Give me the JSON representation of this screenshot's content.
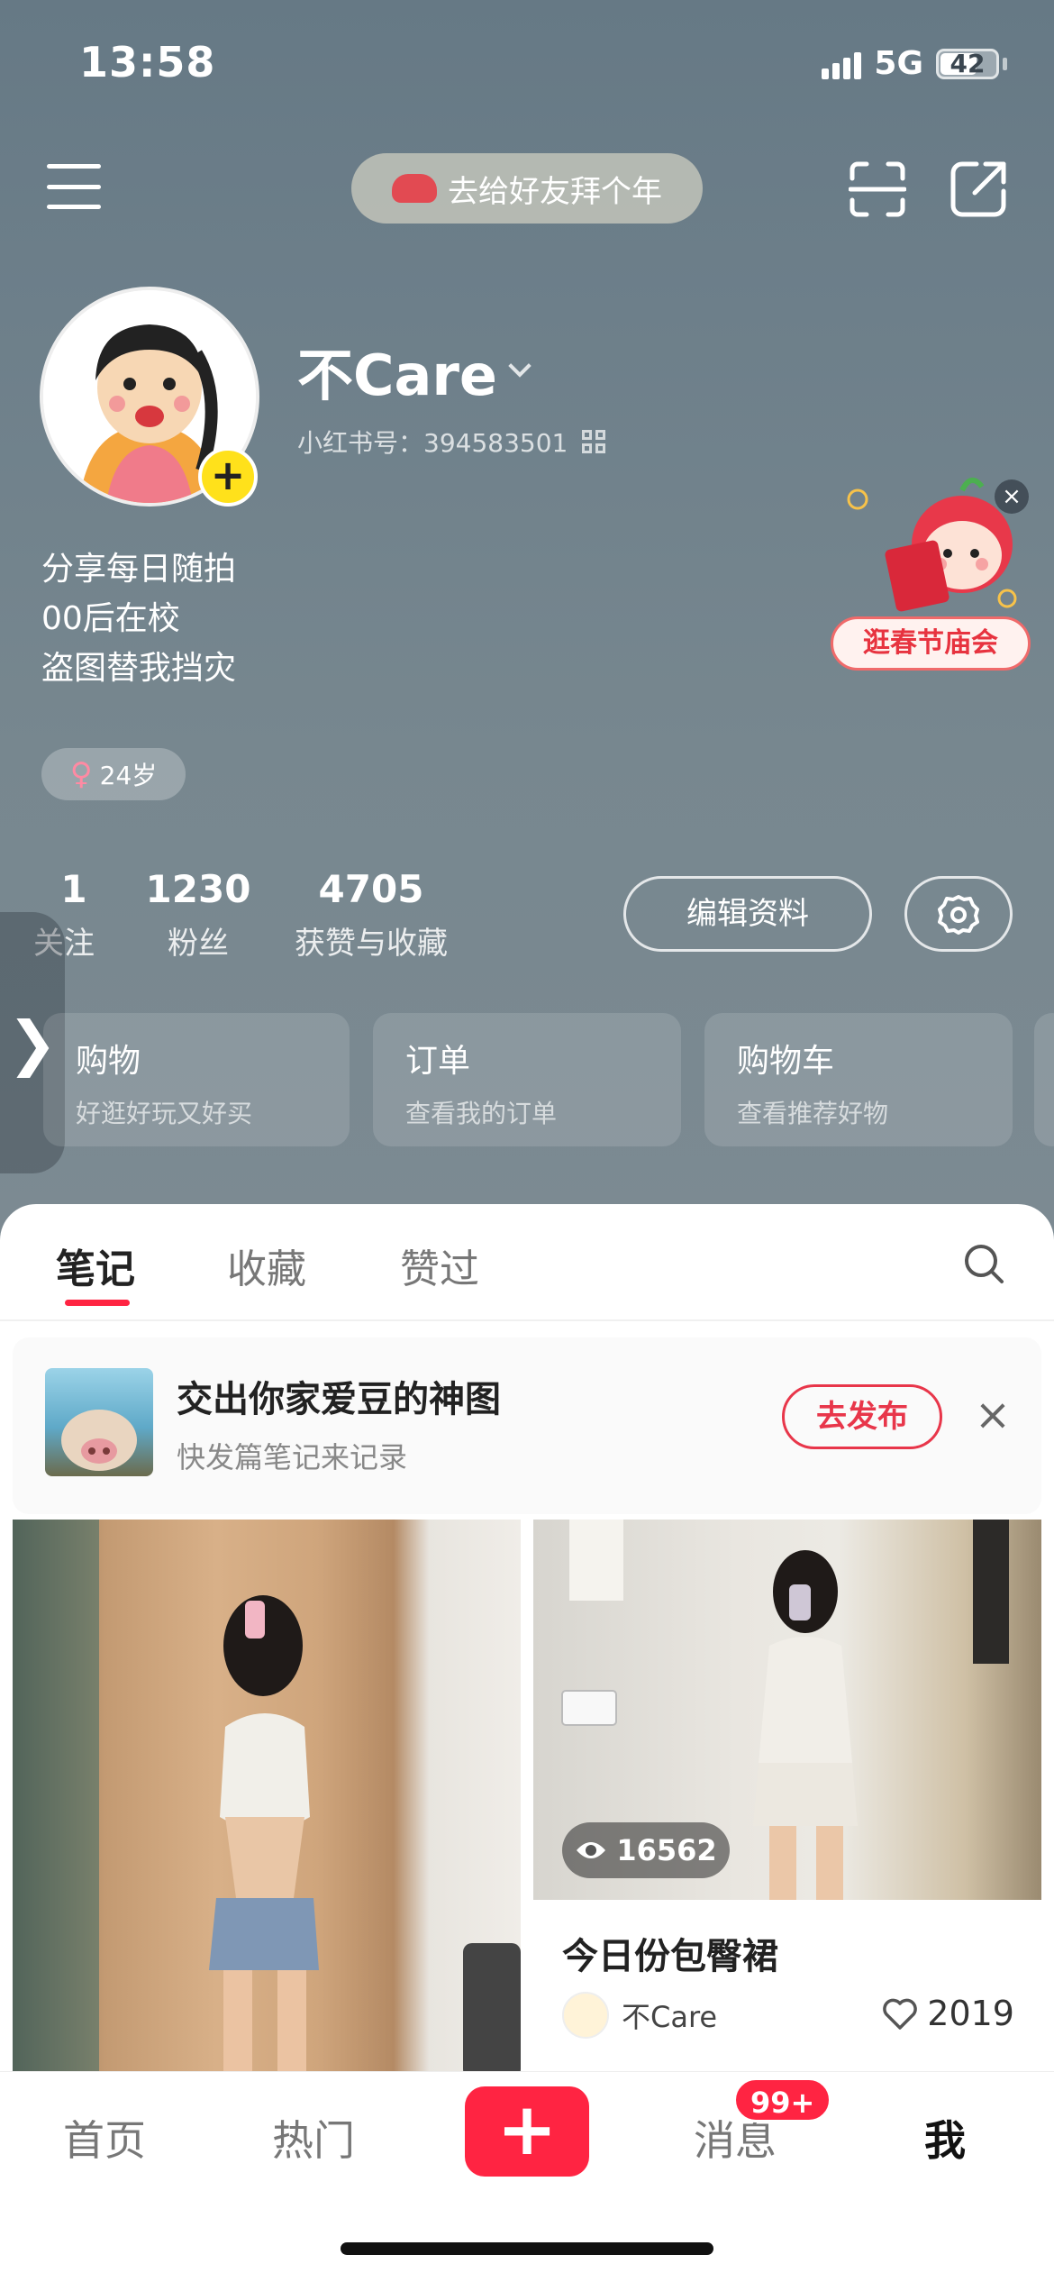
{
  "status_bar": {
    "time": "13:58",
    "network": "5G",
    "battery": "42"
  },
  "top_bar": {
    "new_year_pill": "去给好友拜个年"
  },
  "profile": {
    "nickname": "不Care",
    "red_id": "小红书号：394583501",
    "bio": [
      "分享每日随拍",
      "00后在校",
      "盗图替我挡灾"
    ],
    "age": "24岁"
  },
  "promo": {
    "label": "逛春节庙会",
    "close": "×"
  },
  "stats": [
    {
      "value": "1",
      "label": "关注"
    },
    {
      "value": "1230",
      "label": "粉丝"
    },
    {
      "value": "4705",
      "label": "获赞与收藏"
    }
  ],
  "actions": {
    "edit_profile": "编辑资料"
  },
  "side_tab": "❯",
  "service_cards": [
    {
      "title": "购物",
      "subtitle": "好逛好玩又好买"
    },
    {
      "title": "订单",
      "subtitle": "查看我的订单"
    },
    {
      "title": "购物车",
      "subtitle": "查看推荐好物"
    }
  ],
  "content_tabs": [
    "笔记",
    "收藏",
    "赞过"
  ],
  "publish_prompt": {
    "title": "交出你家爱豆的神图",
    "subtitle": "快发篇笔记来记录",
    "button": "去发布",
    "close": "×"
  },
  "notes": [
    {
      "title": "",
      "views": ""
    },
    {
      "title": "今日份包臀裙",
      "views": "16562",
      "author": "不Care",
      "likes": "2019"
    }
  ],
  "tab_bar": {
    "items": [
      "首页",
      "热门",
      "消息",
      "我"
    ],
    "plus": "+",
    "message_badge": "99+"
  },
  "colors": {
    "brand_red": "#ff2442",
    "hero_bg": "#6d7f8a"
  },
  "icons": [
    "menu-icon",
    "scan-icon",
    "share-icon",
    "settings-icon",
    "search-icon",
    "eye-icon",
    "heart-icon",
    "close-icon",
    "qr-code-icon",
    "female-icon",
    "chevron-down-icon"
  ]
}
